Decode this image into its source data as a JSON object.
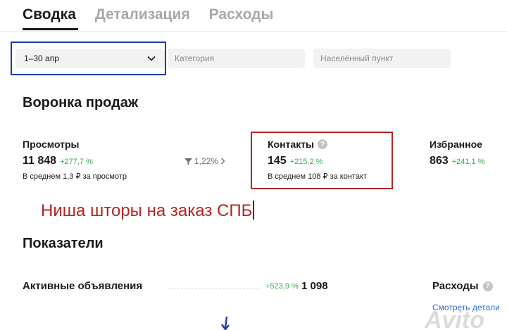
{
  "tabs": [
    {
      "label": "Сводка",
      "active": true
    },
    {
      "label": "Детализация",
      "active": false
    },
    {
      "label": "Расходы",
      "active": false
    }
  ],
  "filters": {
    "date_value": "1–30 апр",
    "category_placeholder": "Категория",
    "city_placeholder": "Населённый пункт"
  },
  "funnel": {
    "title": "Воронка продаж",
    "views": {
      "label": "Просмотры",
      "value": "11 848",
      "delta": "+277,7 %",
      "sub": "В среднем 1,3 ₽ за просмотр"
    },
    "conversion": {
      "value": "1,22%"
    },
    "contacts": {
      "label": "Контакты",
      "value": "145",
      "delta": "+215,2 %",
      "sub": "В среднем 108 ₽ за контакт"
    },
    "favorites": {
      "label": "Избранное",
      "value": "863",
      "delta": "+241,1 %"
    }
  },
  "annotation": "Ниша шторы на заказ СПБ",
  "indicators": {
    "title": "Показатели",
    "active_listings": {
      "label": "Активные объявления",
      "delta": "+523,9 %",
      "value": "1 098"
    },
    "expenses": {
      "label": "Расходы",
      "link": "Смотреть детали"
    }
  },
  "watermark": "Avito",
  "colors": {
    "date_outline": "#1f3aa8",
    "contacts_outline": "#b52420",
    "annotation_text": "#b52420",
    "positive_delta": "#3da84f",
    "link": "#2f6fd6"
  },
  "icons": [
    "chevron-down-icon",
    "funnel-icon",
    "chevron-right-icon",
    "help-icon",
    "arrow-down-icon"
  ]
}
